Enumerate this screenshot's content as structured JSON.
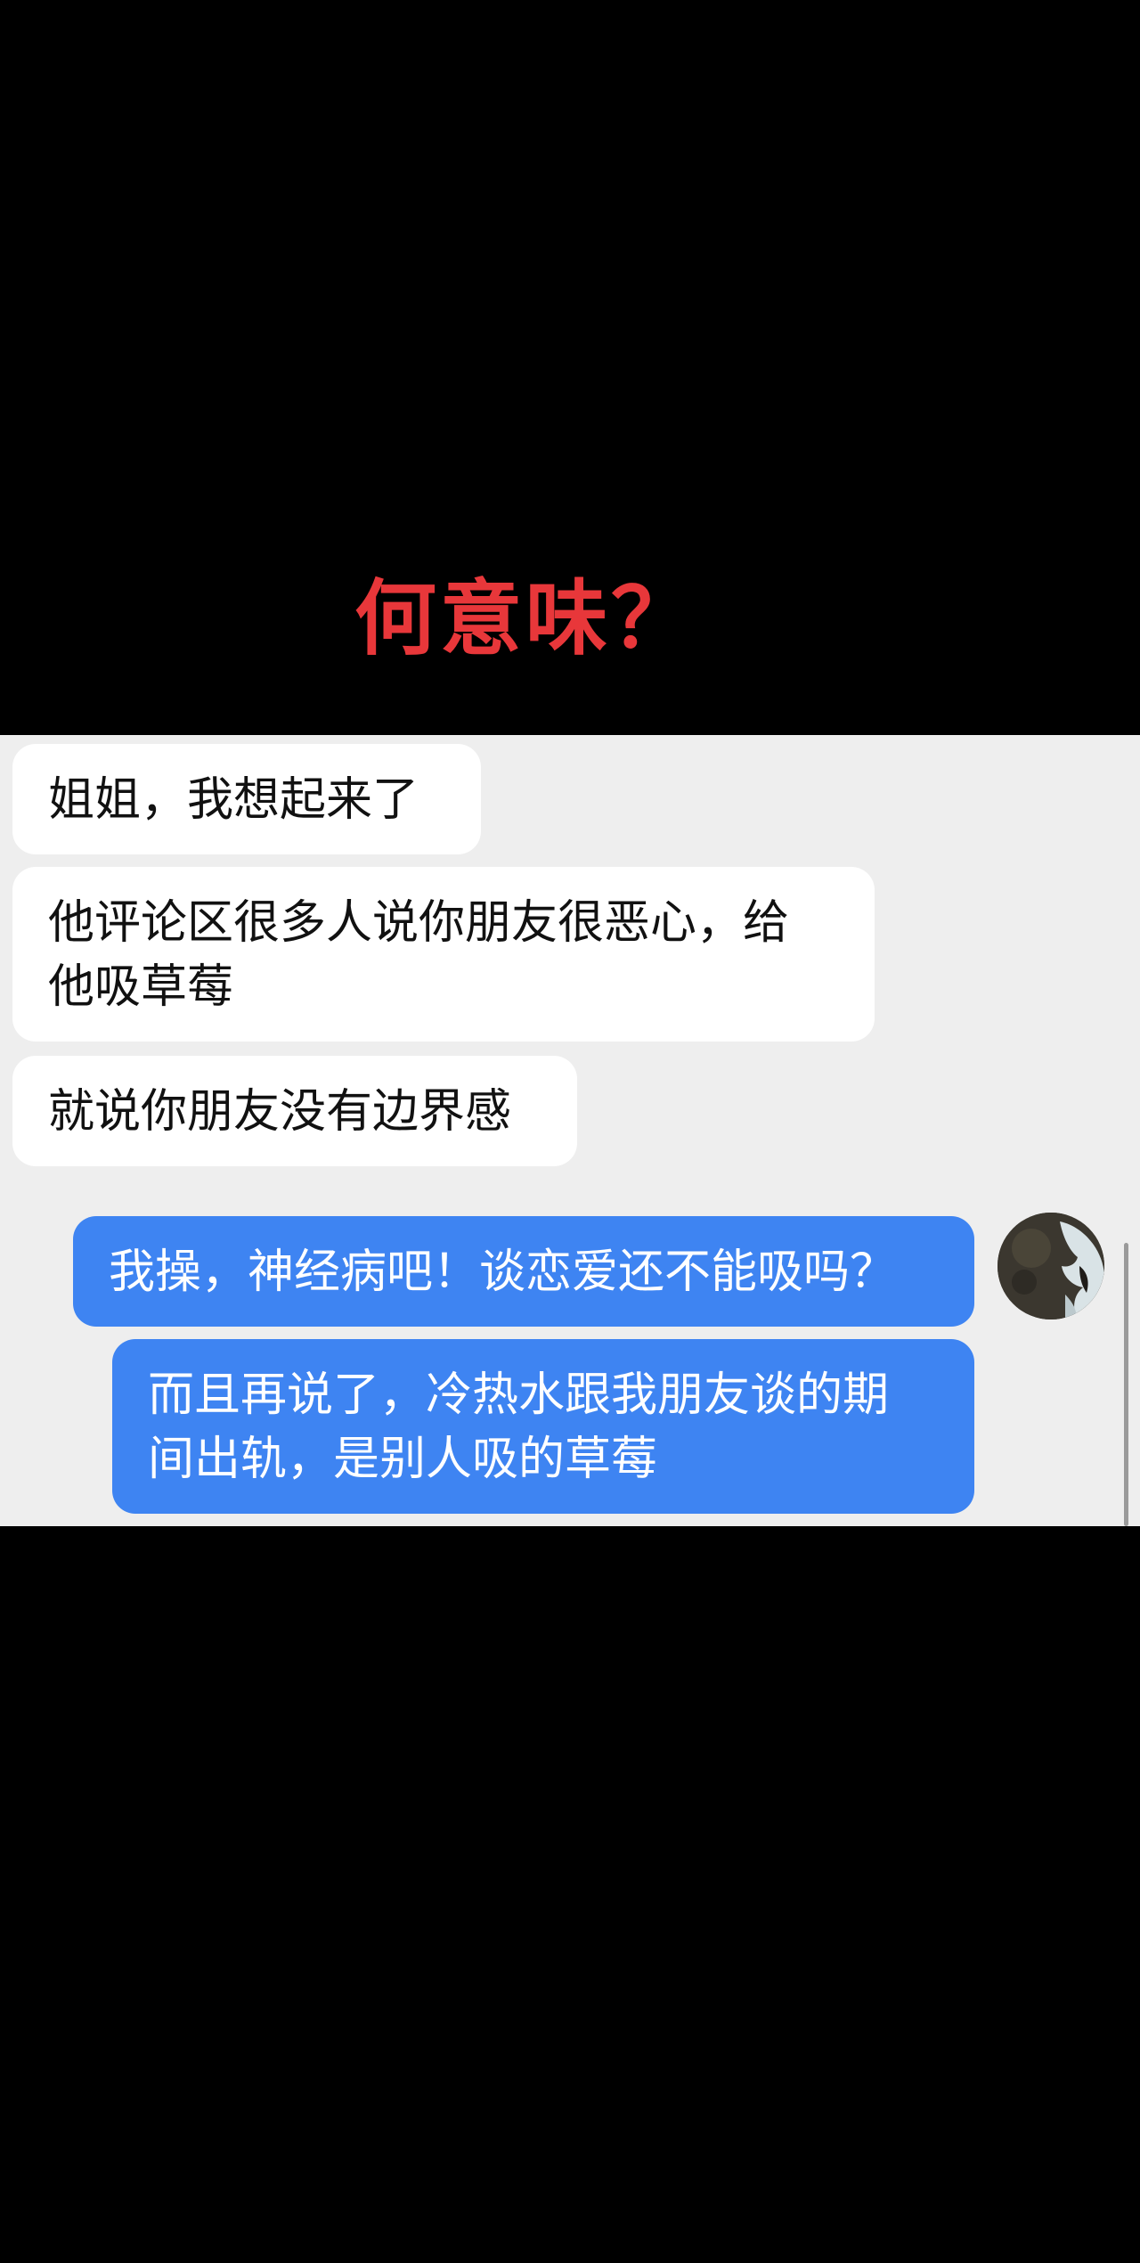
{
  "caption": "何意味？",
  "messages": [
    {
      "side": "incoming",
      "text": "姐姐，我想起来了"
    },
    {
      "side": "incoming",
      "text": "他评论区很多人说你朋友很恶心，给\n他吸草莓"
    },
    {
      "side": "incoming",
      "text": "就说你朋友没有边界感"
    },
    {
      "side": "outgoing",
      "text": "我操，神经病吧！谈恋爱还不能吸吗？"
    },
    {
      "side": "outgoing",
      "text": "而且再说了，冷热水跟我朋友谈的期\n间出轨，是别人吸的草莓"
    }
  ],
  "colors": {
    "caption": "#e8373a",
    "incoming_bubble": "#ffffff",
    "outgoing_bubble": "#3e84f2",
    "chat_background": "#eeeeee"
  }
}
